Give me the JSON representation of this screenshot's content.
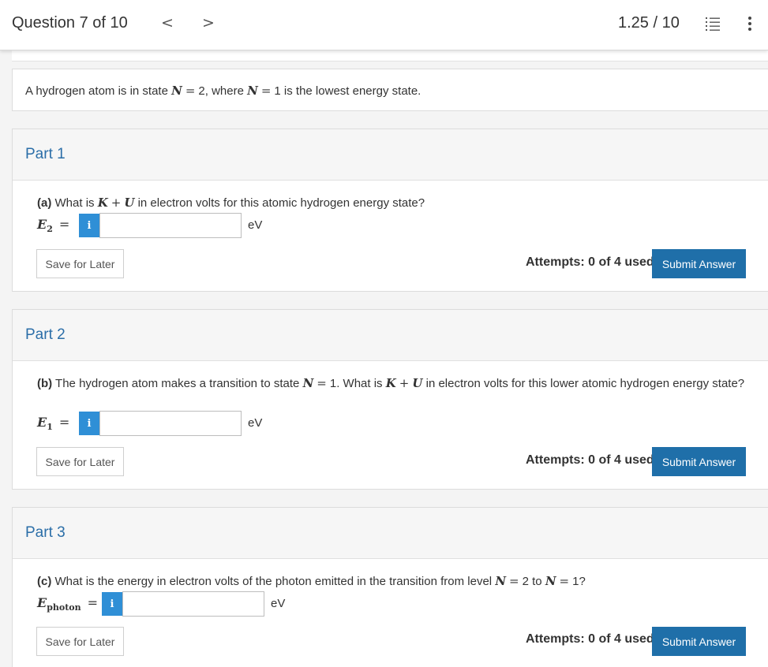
{
  "header": {
    "question_label": "Question 7 of 10",
    "prev_glyph": "<",
    "next_glyph": ">",
    "score": "1.25 / 10"
  },
  "stem": {
    "prefix": "A hydrogen atom is in state ",
    "var_n": "N",
    "eq": "=",
    "val1": "2",
    "mid": ", where ",
    "val2": "1",
    "suffix": " is the lowest energy state."
  },
  "common": {
    "save_label": "Save for Later",
    "submit_label": "Submit Answer",
    "attempts": "Attempts: 0 of 4 used",
    "info_glyph": "i",
    "unit": "eV"
  },
  "parts": [
    {
      "title": "Part 1",
      "lead": "(a)",
      "text_a": " What is ",
      "var_k": "K",
      "plus": "+",
      "var_u": "U",
      "text_b": " in electron volts for this atomic hydrogen energy state?",
      "answer_var": "E",
      "answer_sub": "2",
      "answer_eq": "=",
      "input_value": ""
    },
    {
      "title": "Part 2",
      "lead": "(b)",
      "text_a": " The hydrogen atom makes a transition to state ",
      "var_n": "N",
      "eq": "=",
      "val": "1",
      "text_b": ". What is ",
      "var_k": "K",
      "plus": "+",
      "var_u": "U",
      "text_c": " in electron volts for this lower atomic hydrogen energy state?",
      "answer_var": "E",
      "answer_sub": "1",
      "answer_eq": "=",
      "input_value": ""
    },
    {
      "title": "Part 3",
      "lead": "(c)",
      "text_a": " What is the energy in electron volts of the photon emitted in the transition from level ",
      "var_n": "N",
      "eq": "=",
      "val1": "2",
      "to": " to ",
      "val2": "1",
      "q": "?",
      "answer_var": "E",
      "answer_sub": "photon",
      "answer_eq": "=",
      "input_value": ""
    }
  ]
}
